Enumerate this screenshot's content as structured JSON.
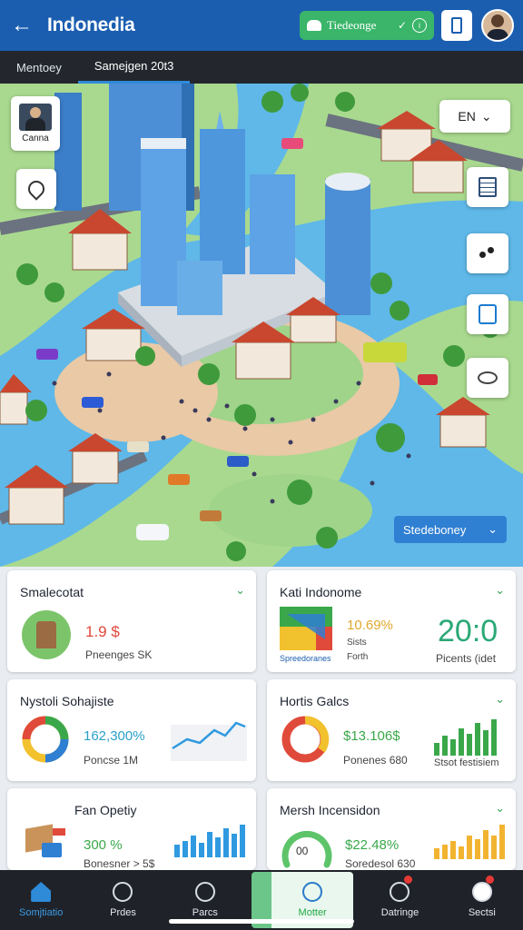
{
  "header": {
    "title": "Indonedia",
    "pill_label": "Tiedeonge",
    "pill_icons": [
      "leaf-icon",
      "check-icon",
      "info-icon"
    ]
  },
  "tabs": [
    {
      "label": "Mentoey",
      "active": false
    },
    {
      "label": "Samejgen 20t3",
      "active": true
    }
  ],
  "map": {
    "profile_name": "Canna",
    "lang_label": "EN",
    "lang_icon": "chevron-down-icon",
    "dropdown_label": "Stedeboney"
  },
  "cards": {
    "c1": {
      "title": "Smalecotat",
      "value": "1.9 $",
      "sub": "Pneenges SK"
    },
    "c2": {
      "title": "Kati Indonome",
      "value": "10.69%",
      "sub1": "Sists",
      "sub2": "Forth",
      "big": "20:0",
      "sub3": "Picents (idet",
      "legend": "Spreedoranes"
    },
    "c3": {
      "title": "Nystoli Sohajiste",
      "value": "162,300%",
      "sub": "Poncse 1M"
    },
    "c4": {
      "title": "Hortis Galcs",
      "value": "$13.106$",
      "sub": "Ponenes 680",
      "sub2": "Stsot festisiem"
    },
    "c5": {
      "title": "Fan Opetiy",
      "value": "300 %",
      "sub": "Bonesner > 5$"
    },
    "c6": {
      "title": "Mersh Incensidon",
      "value": "$22.48%",
      "sub": "Soredesol 630",
      "gauge": "00"
    }
  },
  "nav": [
    {
      "label": "Somjtiatio",
      "icon": "home-icon"
    },
    {
      "label": "Prdes",
      "icon": "globe-icon"
    },
    {
      "label": "Parcs",
      "icon": "people-icon"
    },
    {
      "label": "Motter",
      "icon": "leaf-icon"
    },
    {
      "label": "Datringe",
      "icon": "chat-icon"
    },
    {
      "label": "Sectsi",
      "icon": "face-icon"
    }
  ],
  "colors": {
    "primary": "#1b5eb0",
    "accent_green": "#3ab56a",
    "water": "#5fb8e8",
    "dark_bar": "#23272d"
  }
}
